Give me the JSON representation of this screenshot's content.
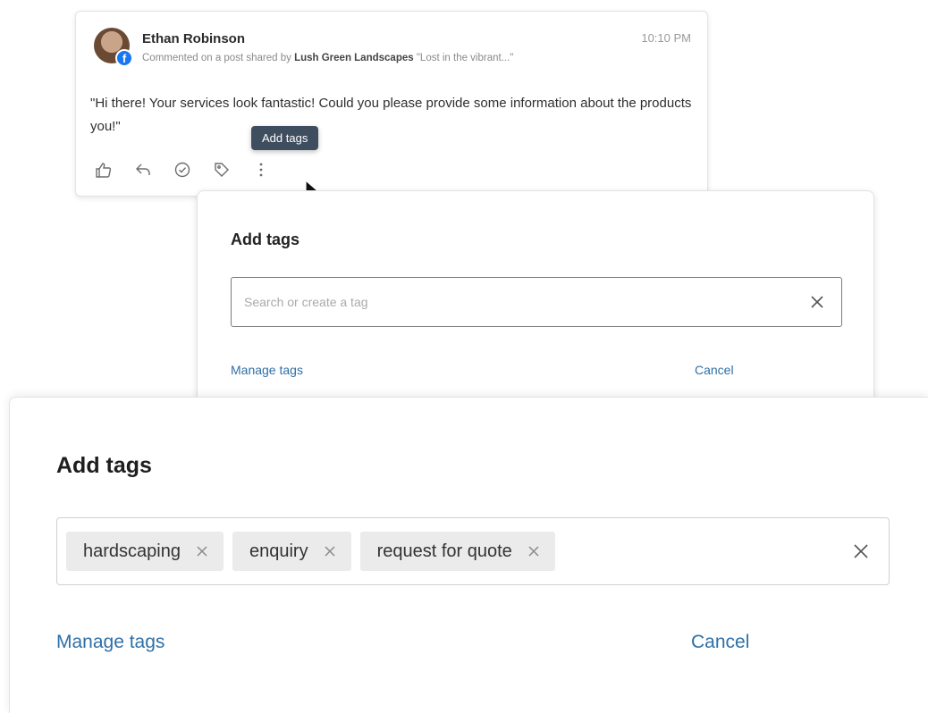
{
  "post": {
    "author": "Ethan Robinson",
    "timestamp": "10:10 PM",
    "activity_prefix": "Commented on a post shared by",
    "page_name": "Lush Green Landscapes",
    "post_snippet": "\"Lost in the vibrant...\"",
    "comment": "\"Hi there! Your services look fantastic! Could you please provide some information about the products you!\"",
    "avatar_badge": "f",
    "actions": [
      {
        "name": "like-icon"
      },
      {
        "name": "reply-icon"
      },
      {
        "name": "check-icon"
      },
      {
        "name": "tag-icon"
      },
      {
        "name": "more-icon"
      }
    ],
    "tooltip": "Add tags"
  },
  "dialog_small": {
    "title": "Add tags",
    "search_placeholder": "Search or create a tag",
    "manage_label": "Manage tags",
    "cancel_label": "Cancel"
  },
  "dialog_large": {
    "title": "Add tags",
    "tags": [
      "hardscaping",
      "enquiry",
      "request for quote"
    ],
    "manage_label": "Manage tags",
    "cancel_label": "Cancel"
  },
  "colors": {
    "link": "#2f6fa6",
    "tooltip_bg": "#3f4e5e",
    "chip_bg": "#ebebeb",
    "facebook": "#1877f2"
  }
}
